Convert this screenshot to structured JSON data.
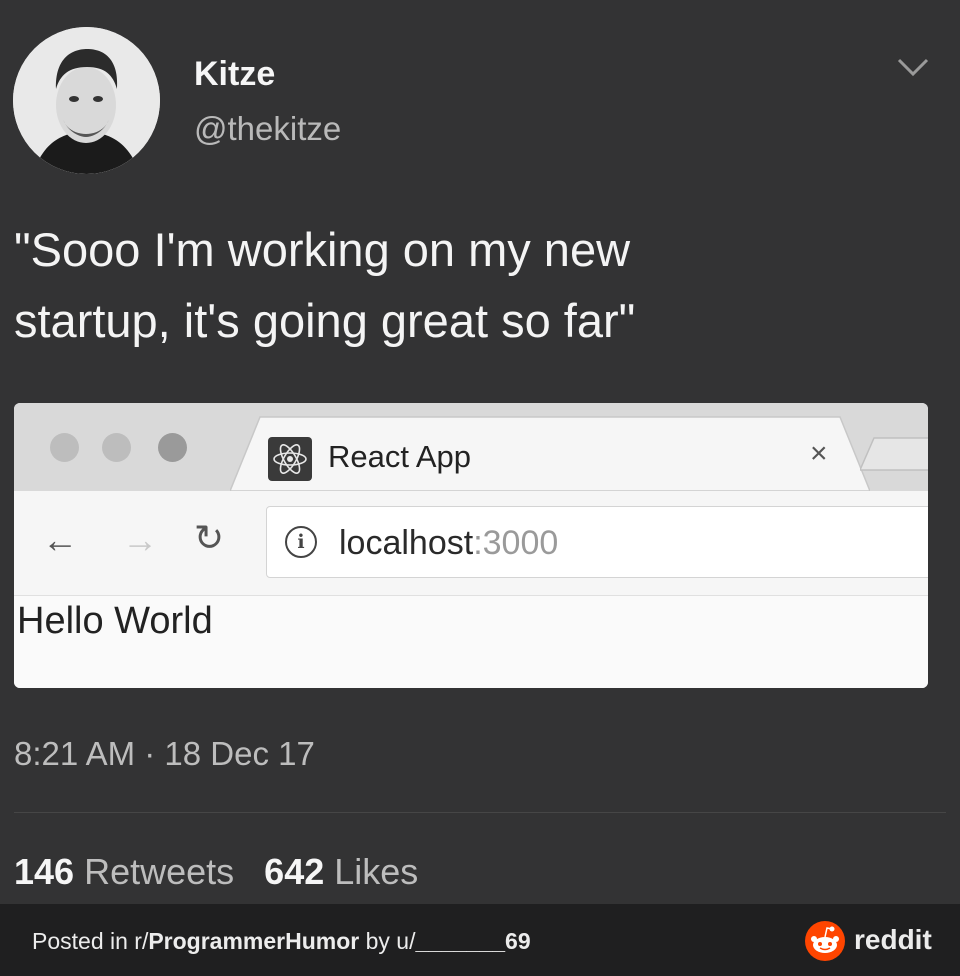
{
  "tweet": {
    "author_name": "Kitze",
    "author_handle": "@thekitze",
    "text": "\"Sooo I'm working on my new\nstartup, it's going great so far\"",
    "timestamp": "8:21 AM · 18 Dec 17",
    "retweets_count": "146",
    "retweets_label": "Retweets",
    "likes_count": "642",
    "likes_label": "Likes"
  },
  "browser": {
    "tab_title": "React App",
    "tab_close": "×",
    "url_host": "localhost",
    "url_port": ":3000",
    "page_text": "Hello World",
    "icons": {
      "favicon": "react-icon",
      "back": "arrow-left-icon",
      "forward": "arrow-right-icon",
      "reload": "reload-icon",
      "info": "info-icon"
    }
  },
  "footer": {
    "prefix": "Posted in r/",
    "subreddit": "ProgrammerHumor",
    "by": " by u/",
    "user": "_______69",
    "brand": "reddit"
  },
  "colors": {
    "background": "#333334",
    "footer_bg": "#1f1f20",
    "reddit_orange": "#ff4500"
  }
}
